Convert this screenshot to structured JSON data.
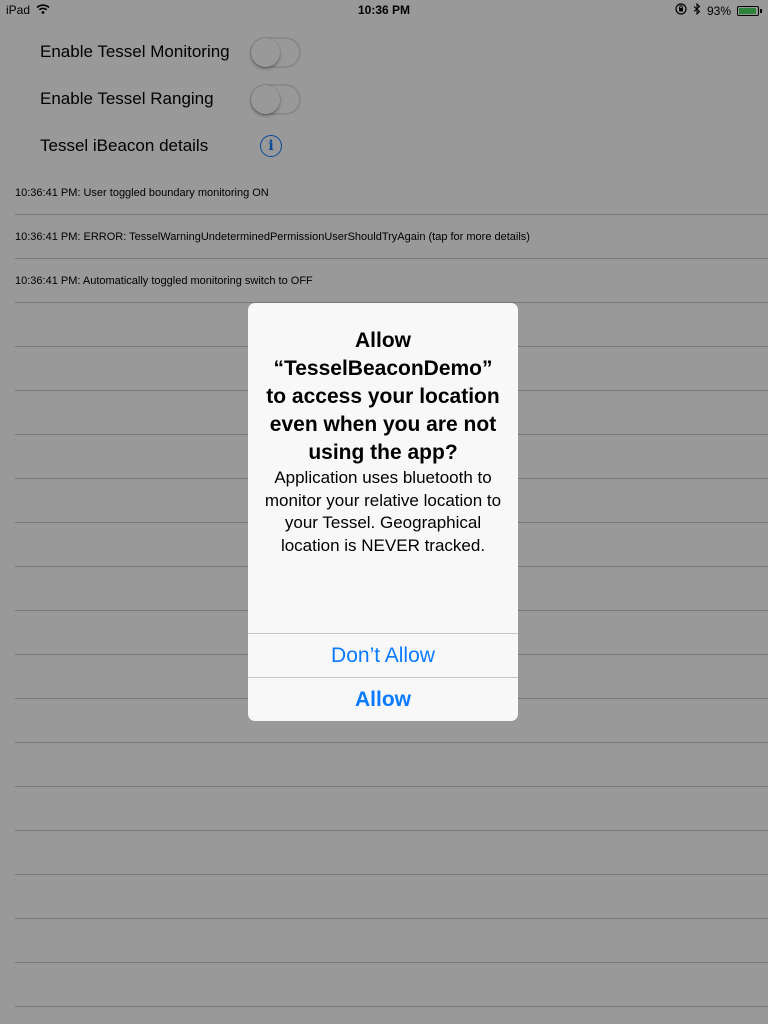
{
  "status_bar": {
    "device": "iPad",
    "time": "10:36 PM",
    "battery_percent": "93%",
    "battery_level": 0.93,
    "icons": [
      "wifi-icon",
      "orientation-lock-icon",
      "bluetooth-icon",
      "battery-icon"
    ]
  },
  "settings": {
    "monitoring_label": "Enable Tessel Monitoring",
    "monitoring_on": false,
    "ranging_label": "Enable Tessel Ranging",
    "ranging_on": false,
    "details_label": "Tessel iBeacon details",
    "details_icon": "info-icon"
  },
  "log": [
    "10:36:41 PM: User toggled boundary monitoring ON",
    "10:36:41 PM: ERROR: TesselWarningUndeterminedPermissionUserShouldTryAgain (tap for more details)",
    "10:36:41 PM: Automatically toggled monitoring switch to OFF"
  ],
  "alert": {
    "title": "Allow “TesselBeaconDemo” to access your location even when you are not using the app?",
    "message": "Application uses bluetooth to monitor your relative location to your Tessel. Geographical location is NEVER tracked.",
    "dont_allow_label": "Don’t Allow",
    "allow_label": "Allow"
  },
  "colors": {
    "accent": "#0a7aff",
    "separator": "#c8c7cc",
    "toggle_off_border": "#e5e5e5",
    "battery_fill": "#4cd964"
  }
}
